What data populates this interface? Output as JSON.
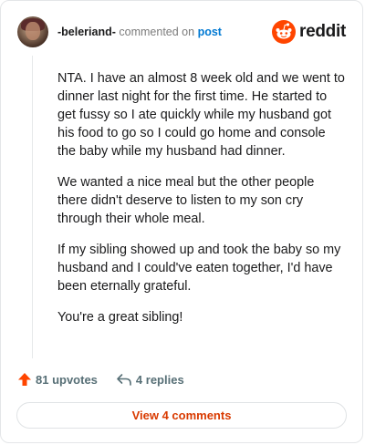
{
  "header": {
    "username": "-beleriand-",
    "action_text": "commented on",
    "post_link": "post",
    "brand": "reddit"
  },
  "comment": {
    "paragraphs": [
      "NTA. I have an almost 8 week old and we went to dinner last night for the first time. He started to get fussy so I ate quickly while my husband got his food to go so I could go home and console the baby while my husband had dinner.",
      "We wanted a nice meal but the other people there didn't deserve to listen to my son cry through their whole meal.",
      "If my sibling showed up and took the baby so my husband and I could've eaten together, I'd have been eternally grateful.",
      "You're a great sibling!"
    ]
  },
  "actions": {
    "upvotes": "81 upvotes",
    "replies": "4 replies"
  },
  "view_comments": "View 4 comments",
  "colors": {
    "reddit_orange": "#ff4500",
    "link_blue": "#0079d3",
    "view_button_text": "#d93a00"
  },
  "icons": [
    "avatar",
    "reddit-logo-icon",
    "upvote-arrow-icon",
    "reply-icon"
  ]
}
